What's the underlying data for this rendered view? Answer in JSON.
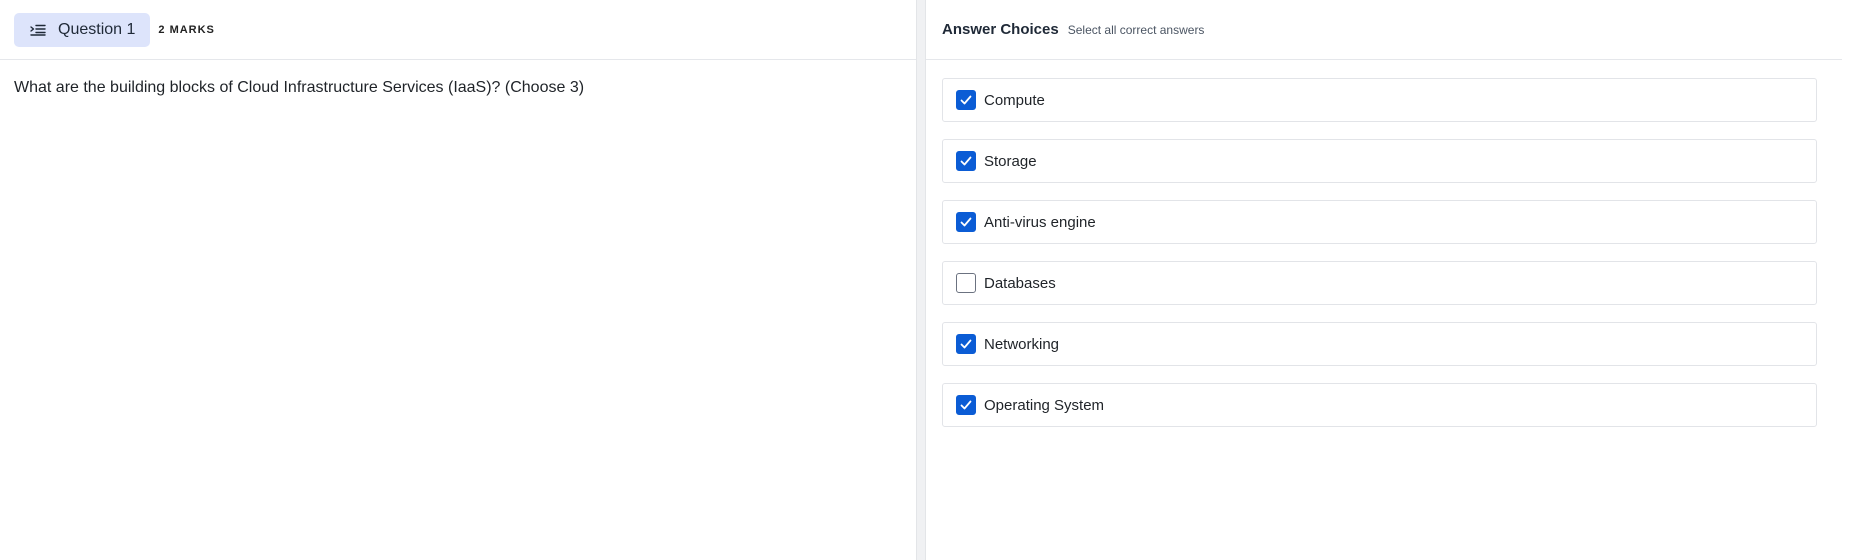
{
  "question": {
    "chip_label": "Question 1",
    "chip_icon": "list-indent-icon",
    "marks": "2 MARKS",
    "text": "What are the building blocks of Cloud Infrastructure Services (IaaS)? (Choose 3)"
  },
  "answers": {
    "title": "Answer Choices",
    "subtitle": "Select all correct answers",
    "choices": [
      {
        "label": "Compute",
        "checked": true
      },
      {
        "label": "Storage",
        "checked": true
      },
      {
        "label": "Anti-virus engine",
        "checked": true
      },
      {
        "label": "Databases",
        "checked": false
      },
      {
        "label": "Networking",
        "checked": true
      },
      {
        "label": "Operating System",
        "checked": true
      }
    ]
  },
  "colors": {
    "accent": "#0b5cd5",
    "chip_bg": "#dde4fb"
  }
}
